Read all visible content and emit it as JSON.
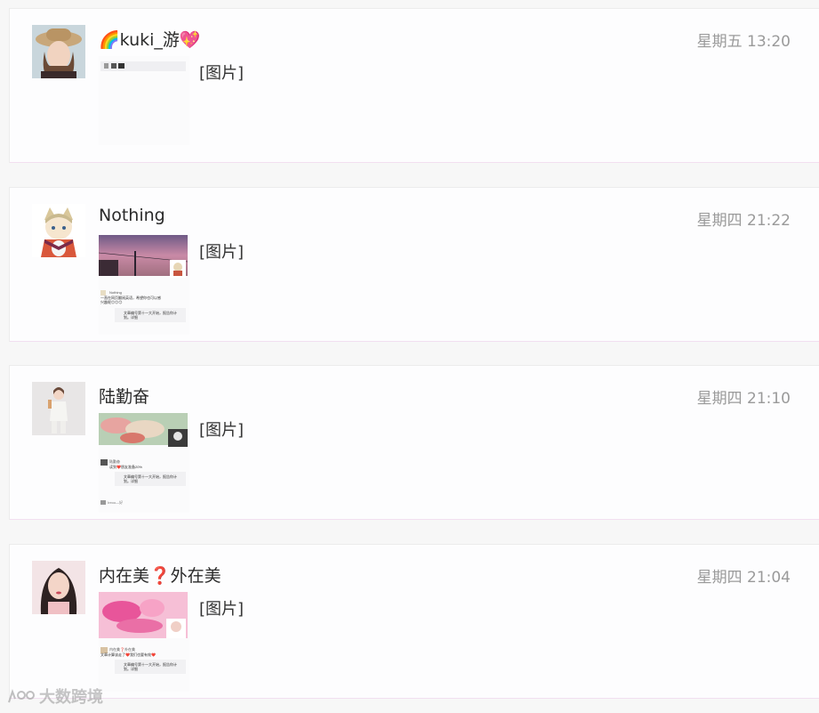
{
  "messages": [
    {
      "name": "🌈kuki_游💖",
      "time": "星期五 13:20",
      "tag": "[图片]"
    },
    {
      "name": "Nothing",
      "time": "星期四 21:22",
      "tag": "[图片]",
      "preview": {
        "author": "Nothing",
        "text1": "一直在网页翻阅英语，希望你也可以感",
        "text2": "兴趣呢😊😊😊",
        "share1": "文章编号第十一大开始，报告你计",
        "share2": "划。详细"
      }
    },
    {
      "name": "陆勤奋",
      "time": "星期四 21:10",
      "tag": "[图片]",
      "preview": {
        "author": "陆勤奋",
        "text1": "读到❤️朋友准备20%",
        "share1": "文章编号第十一大开始，报告你计",
        "share2": "划。详细",
        "footer": "Ireoo—好"
      }
    },
    {
      "name": "内在美❓外在美",
      "time": "星期四 21:04",
      "tag": "[图片]",
      "preview": {
        "author": "内在美❓外在美",
        "text1": "文章计算该走了❤️我们也要有效❤️",
        "share1": "文章编号第十一大开始，报告你计",
        "share2": "划。详细"
      }
    }
  ],
  "watermark": "大数跨境"
}
